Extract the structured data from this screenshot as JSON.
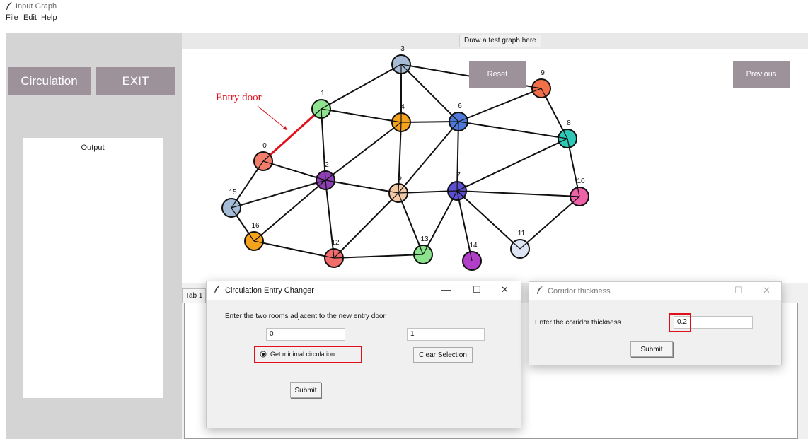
{
  "window": {
    "title": "Input Graph"
  },
  "menu": [
    "File",
    "Edit",
    "Help"
  ],
  "left_panel": {
    "circulation_label": "Circulation",
    "exit_label": "EXIT",
    "output_label": "Output"
  },
  "canvas": {
    "header": "Draw a test graph here",
    "reset_label": "Reset",
    "previous_label": "Previous",
    "annotation": "Entry door"
  },
  "graph": {
    "nodes": [
      {
        "label": "0",
        "color": "#f27d6b"
      },
      {
        "label": "1",
        "color": "#8fe28f"
      },
      {
        "label": "2",
        "color": "#8e3fb5"
      },
      {
        "label": "3",
        "color": "#a7bbd4"
      },
      {
        "label": "4",
        "color": "#f5a21c"
      },
      {
        "label": "5",
        "color": "#f3c9a6"
      },
      {
        "label": "6",
        "color": "#4f79d8"
      },
      {
        "label": "7",
        "color": "#5b4fd2"
      },
      {
        "label": "8",
        "color": "#2ec8b6"
      },
      {
        "label": "9",
        "color": "#f27049"
      },
      {
        "label": "10",
        "color": "#ee62a8"
      },
      {
        "label": "11",
        "color": "#dde4f3"
      },
      {
        "label": "12",
        "color": "#f26c6c"
      },
      {
        "label": "13",
        "color": "#8be38d"
      },
      {
        "label": "14",
        "color": "#b13fc9"
      },
      {
        "label": "15",
        "color": "#a5bcd6"
      },
      {
        "label": "16",
        "color": "#f5a21c"
      }
    ],
    "edges": [
      [
        0,
        1
      ],
      [
        0,
        2
      ],
      [
        0,
        15
      ],
      [
        1,
        2
      ],
      [
        1,
        3
      ],
      [
        1,
        4
      ],
      [
        2,
        4
      ],
      [
        2,
        5
      ],
      [
        2,
        12
      ],
      [
        2,
        15
      ],
      [
        2,
        16
      ],
      [
        3,
        4
      ],
      [
        3,
        6
      ],
      [
        3,
        9
      ],
      [
        4,
        6
      ],
      [
        4,
        5
      ],
      [
        5,
        6
      ],
      [
        5,
        7
      ],
      [
        5,
        12
      ],
      [
        5,
        13
      ],
      [
        6,
        9
      ],
      [
        6,
        8
      ],
      [
        6,
        7
      ],
      [
        7,
        8
      ],
      [
        7,
        10
      ],
      [
        7,
        11
      ],
      [
        7,
        13
      ],
      [
        7,
        14
      ],
      [
        8,
        9
      ],
      [
        8,
        10
      ],
      [
        10,
        11
      ],
      [
        12,
        13
      ],
      [
        12,
        16
      ],
      [
        15,
        16
      ]
    ],
    "entry_edge": [
      0,
      1
    ]
  },
  "tab": {
    "label": "Tab 1"
  },
  "entry_dialog": {
    "title": "Circulation Entry Changer",
    "prompt": "Enter the two rooms adjacent to the new entry door",
    "room_a": "0",
    "room_b": "1",
    "radio_label": "Get minimal circulation",
    "clear_label": "Clear Selection",
    "submit_label": "Submit"
  },
  "corridor_dialog": {
    "title": "Corridor thickness",
    "prompt": "Enter the corridor thickness",
    "value": "0.2",
    "submit_label": "Submit"
  },
  "window_controls": {
    "minimize": "—",
    "maximize": "☐",
    "close": "✕"
  },
  "colors": {
    "button": "#9d919a",
    "panel": "#d4d4d4",
    "highlight": "#e0101a"
  }
}
